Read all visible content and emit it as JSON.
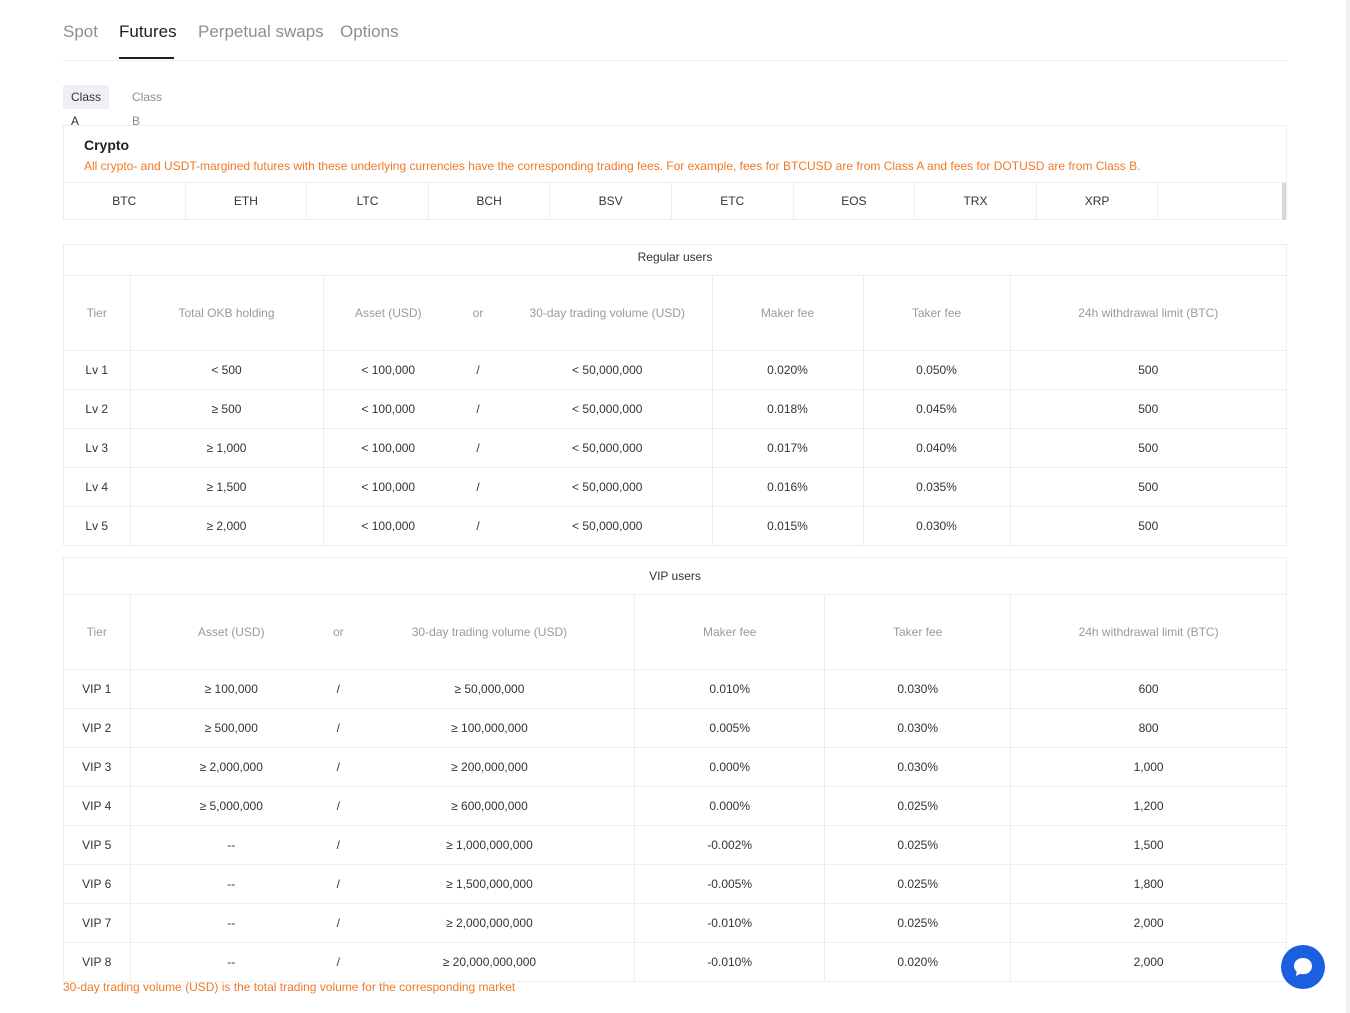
{
  "tabs": [
    {
      "label": "Spot",
      "active": false
    },
    {
      "label": "Futures",
      "active": true
    },
    {
      "label": "Perpetual swaps",
      "active": false
    },
    {
      "label": "Options",
      "active": false
    }
  ],
  "class_tabs": [
    {
      "label": "Class A",
      "active": true
    },
    {
      "label": "Class B",
      "active": false
    }
  ],
  "crypto": {
    "title": "Crypto",
    "description": "All crypto- and USDT-margined futures with these underlying currencies have the corresponding trading fees. For example, fees for BTCUSD are from Class A and fees for DOTUSD are from Class B.",
    "coins": [
      "BTC",
      "ETH",
      "LTC",
      "BCH",
      "BSV",
      "ETC",
      "EOS",
      "TRX",
      "XRP"
    ]
  },
  "regular": {
    "caption": "Regular users",
    "headers": {
      "tier": "Tier",
      "okb": "Total OKB holding",
      "asset": "Asset (USD)",
      "or": "or",
      "volume": "30-day trading volume (USD)",
      "maker": "Maker fee",
      "taker": "Taker fee",
      "limit": "24h withdrawal limit (BTC)"
    },
    "rows": [
      {
        "tier": "Lv 1",
        "okb": "< 500",
        "asset": "< 100,000",
        "sep": "/",
        "volume": "< 50,000,000",
        "maker": "0.020%",
        "taker": "0.050%",
        "limit": "500"
      },
      {
        "tier": "Lv 2",
        "okb": "≥ 500",
        "asset": "< 100,000",
        "sep": "/",
        "volume": "< 50,000,000",
        "maker": "0.018%",
        "taker": "0.045%",
        "limit": "500"
      },
      {
        "tier": "Lv 3",
        "okb": "≥ 1,000",
        "asset": "< 100,000",
        "sep": "/",
        "volume": "< 50,000,000",
        "maker": "0.017%",
        "taker": "0.040%",
        "limit": "500"
      },
      {
        "tier": "Lv 4",
        "okb": "≥ 1,500",
        "asset": "< 100,000",
        "sep": "/",
        "volume": "< 50,000,000",
        "maker": "0.016%",
        "taker": "0.035%",
        "limit": "500"
      },
      {
        "tier": "Lv 5",
        "okb": "≥ 2,000",
        "asset": "< 100,000",
        "sep": "/",
        "volume": "< 50,000,000",
        "maker": "0.015%",
        "taker": "0.030%",
        "limit": "500"
      }
    ]
  },
  "vip": {
    "caption": "VIP users",
    "headers": {
      "tier": "Tier",
      "asset": "Asset (USD)",
      "or": "or",
      "volume": "30-day trading volume (USD)",
      "maker": "Maker fee",
      "taker": "Taker fee",
      "limit": "24h withdrawal limit (BTC)"
    },
    "rows": [
      {
        "tier": "VIP 1",
        "asset": "≥ 100,000",
        "sep": "/",
        "volume": "≥ 50,000,000",
        "maker": "0.010%",
        "taker": "0.030%",
        "limit": "600"
      },
      {
        "tier": "VIP 2",
        "asset": "≥ 500,000",
        "sep": "/",
        "volume": "≥ 100,000,000",
        "maker": "0.005%",
        "taker": "0.030%",
        "limit": "800"
      },
      {
        "tier": "VIP 3",
        "asset": "≥ 2,000,000",
        "sep": "/",
        "volume": "≥ 200,000,000",
        "maker": "0.000%",
        "taker": "0.030%",
        "limit": "1,000"
      },
      {
        "tier": "VIP 4",
        "asset": "≥ 5,000,000",
        "sep": "/",
        "volume": "≥ 600,000,000",
        "maker": "0.000%",
        "taker": "0.025%",
        "limit": "1,200"
      },
      {
        "tier": "VIP 5",
        "asset": "--",
        "sep": "/",
        "volume": "≥ 1,000,000,000",
        "maker": "-0.002%",
        "taker": "0.025%",
        "limit": "1,500"
      },
      {
        "tier": "VIP 6",
        "asset": "--",
        "sep": "/",
        "volume": "≥ 1,500,000,000",
        "maker": "-0.005%",
        "taker": "0.025%",
        "limit": "1,800"
      },
      {
        "tier": "VIP 7",
        "asset": "--",
        "sep": "/",
        "volume": "≥ 2,000,000,000",
        "maker": "-0.010%",
        "taker": "0.025%",
        "limit": "2,000"
      },
      {
        "tier": "VIP 8",
        "asset": "--",
        "sep": "/",
        "volume": "≥ 20,000,000,000",
        "maker": "-0.010%",
        "taker": "0.020%",
        "limit": "2,000"
      }
    ]
  },
  "footnote": "30-day trading volume (USD) is the total trading volume for the corresponding market",
  "chat": {
    "icon": "chat-bubble-icon",
    "color": "#1c5ee0"
  },
  "colors": {
    "accent_orange": "#ee7a26",
    "active_tab": "#1f1f1f"
  }
}
